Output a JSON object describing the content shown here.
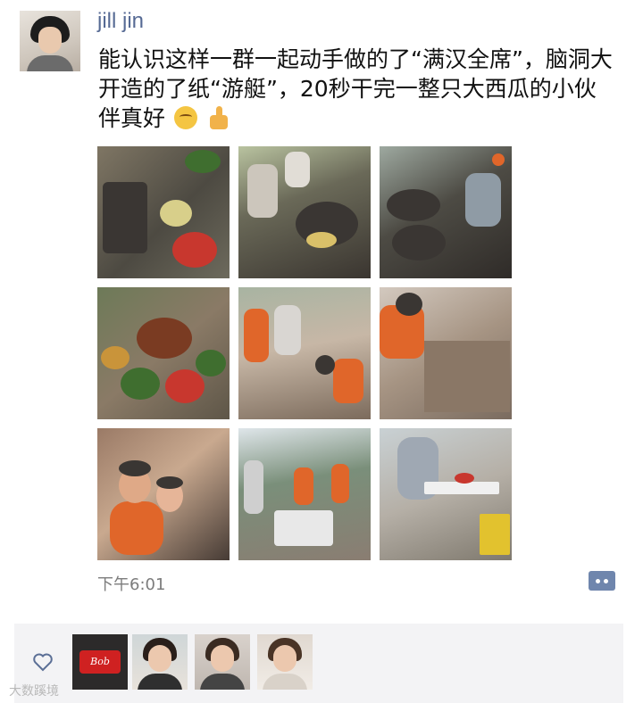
{
  "post": {
    "username": "jill jin",
    "text": "能认识这样一群一起动手做的了“满汉全席”，脑洞大开造的了纸“游艇”，20秒干完一整只大西瓜的小伙伴真好",
    "emojis": [
      "thinking-face-icon",
      "thumbs-up-icon"
    ],
    "timestamp": "下午6:01",
    "photo_count": 9
  },
  "likes": {
    "avatars": [
      {
        "label": "Bob"
      },
      {
        "label": ""
      },
      {
        "label": ""
      },
      {
        "label": ""
      }
    ]
  },
  "watermark": "大数蹊境",
  "colors": {
    "username": "#566a94",
    "comment_button": "#6f86ad",
    "likes_bar": "#f3f3f5"
  }
}
